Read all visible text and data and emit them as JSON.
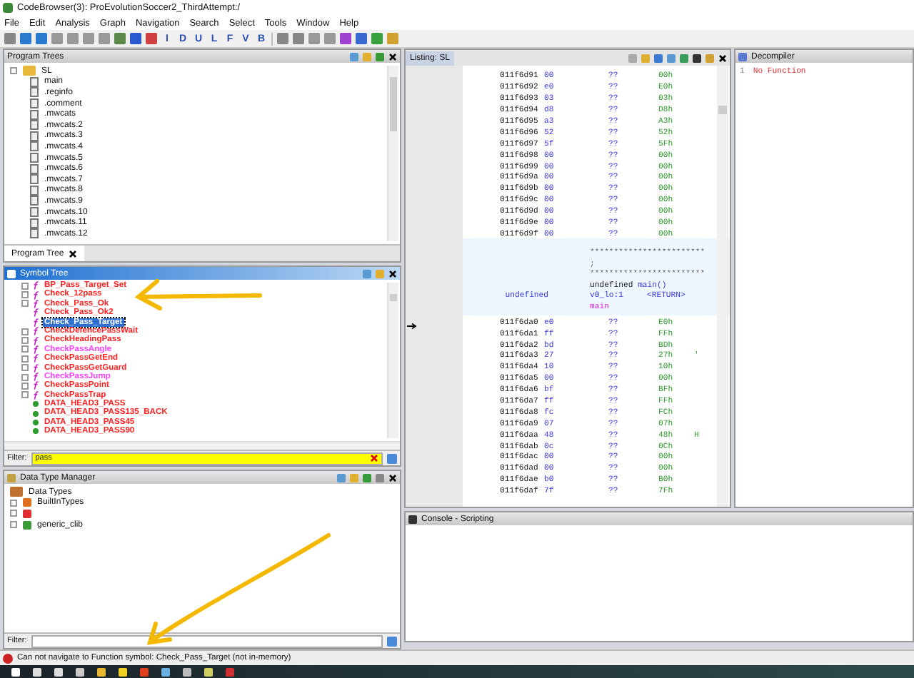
{
  "window": {
    "title": "CodeBrowser(3): ProEvolutionSoccer2_ThirdAttempt:/"
  },
  "menu": [
    "File",
    "Edit",
    "Analysis",
    "Graph",
    "Navigation",
    "Search",
    "Select",
    "Tools",
    "Window",
    "Help"
  ],
  "toolbar": {
    "letter_buttons": [
      "I",
      "D",
      "U",
      "L",
      "F",
      "V",
      "B"
    ]
  },
  "program_trees": {
    "title": "Program Trees",
    "root": "SL",
    "items": [
      "main",
      ".reginfo",
      ".comment",
      ".mwcats",
      ".mwcats.2",
      ".mwcats.3",
      ".mwcats.4",
      ".mwcats.5",
      ".mwcats.6",
      ".mwcats.7",
      ".mwcats.8",
      ".mwcats.9",
      ".mwcats.10",
      ".mwcats.11",
      ".mwcats.12"
    ],
    "tab": "Program Tree"
  },
  "symbol_tree": {
    "title": "Symbol Tree",
    "items": [
      {
        "label": "BP_Pass_Target_Set",
        "kind": "function",
        "color": "#ff2020",
        "expandable": true,
        "selected": false
      },
      {
        "label": "Check_12pass",
        "kind": "function",
        "color": "#ff2020",
        "expandable": true,
        "selected": false
      },
      {
        "label": "Check_Pass_Ok",
        "kind": "function",
        "color": "#ff2020",
        "expandable": true,
        "selected": false
      },
      {
        "label": "Check_Pass_Ok2",
        "kind": "function",
        "color": "#ff2020",
        "expandable": false,
        "selected": false
      },
      {
        "label": "Check_Pass_Target",
        "kind": "function",
        "expandable": false,
        "selected": true
      },
      {
        "label": "CheckDefencePassWait",
        "kind": "function",
        "color": "#ff2020",
        "expandable": true,
        "selected": false
      },
      {
        "label": "CheckHeadingPass",
        "kind": "function",
        "color": "#ff2020",
        "expandable": true,
        "selected": false
      },
      {
        "label": "CheckPassAngle",
        "kind": "function",
        "color": "#ff40ff",
        "expandable": true,
        "selected": false
      },
      {
        "label": "CheckPassGetEnd",
        "kind": "function",
        "color": "#ff2020",
        "expandable": true,
        "selected": false
      },
      {
        "label": "CheckPassGetGuard",
        "kind": "function",
        "color": "#ff2020",
        "expandable": true,
        "selected": false
      },
      {
        "label": "CheckPassJump",
        "kind": "function",
        "color": "#ff40ff",
        "expandable": true,
        "selected": false
      },
      {
        "label": "CheckPassPoint",
        "kind": "function",
        "color": "#ff2020",
        "expandable": true,
        "selected": false
      },
      {
        "label": "CheckPassTrap",
        "kind": "function",
        "color": "#ff2020",
        "expandable": true,
        "selected": false
      },
      {
        "label": "DATA_HEAD3_PASS",
        "kind": "data",
        "color": "#ff2020",
        "expandable": false,
        "selected": false
      },
      {
        "label": "DATA_HEAD3_PASS135_BACK",
        "kind": "data",
        "color": "#ff2020",
        "expandable": false,
        "selected": false
      },
      {
        "label": "DATA_HEAD3_PASS45",
        "kind": "data",
        "color": "#ff2020",
        "expandable": false,
        "selected": false
      },
      {
        "label": "DATA_HEAD3_PASS90",
        "kind": "data",
        "color": "#ff2020",
        "expandable": false,
        "selected": false
      }
    ],
    "filter_label": "Filter:",
    "filter_value": "pass"
  },
  "data_type_manager": {
    "title": "Data Type Manager",
    "root": "Data Types",
    "items": [
      {
        "kind": "builtin",
        "label": "BuiltInTypes"
      },
      {
        "kind": "program"
      },
      {
        "kind": "archive",
        "label": "generic_clib"
      }
    ],
    "filter_label": "Filter:"
  },
  "listing": {
    "tab": "Listing: SL",
    "rows_before": [
      {
        "address": "011f6d91",
        "byte": "00",
        "mnemonic": "??",
        "value": "00h"
      },
      {
        "address": "011f6d92",
        "byte": "e0",
        "mnemonic": "??",
        "value": "E0h"
      },
      {
        "address": "011f6d93",
        "byte": "03",
        "mnemonic": "??",
        "value": "03h"
      },
      {
        "address": "011f6d94",
        "byte": "d8",
        "mnemonic": "??",
        "value": "D8h"
      },
      {
        "address": "011f6d95",
        "byte": "a3",
        "mnemonic": "??",
        "value": "A3h"
      },
      {
        "address": "011f6d96",
        "byte": "52",
        "mnemonic": "??",
        "value": "52h"
      },
      {
        "address": "011f6d97",
        "byte": "5f",
        "mnemonic": "??",
        "value": "5Fh"
      },
      {
        "address": "011f6d98",
        "byte": "00",
        "mnemonic": "??",
        "value": "00h"
      },
      {
        "address": "011f6d99",
        "byte": "00",
        "mnemonic": "??",
        "value": "00h"
      },
      {
        "address": "011f6d9a",
        "byte": "00",
        "mnemonic": "??",
        "value": "00h"
      },
      {
        "address": "011f6d9b",
        "byte": "00",
        "mnemonic": "??",
        "value": "00h"
      },
      {
        "address": "011f6d9c",
        "byte": "00",
        "mnemonic": "??",
        "value": "00h"
      },
      {
        "address": "011f6d9d",
        "byte": "00",
        "mnemonic": "??",
        "value": "00h"
      },
      {
        "address": "011f6d9e",
        "byte": "00",
        "mnemonic": "??",
        "value": "00h"
      },
      {
        "address": "011f6d9f",
        "byte": "00",
        "mnemonic": "??",
        "value": "00h"
      }
    ],
    "function_header": {
      "stars_top": "************************",
      "semicolon": ";",
      "stars_bottom": "************************",
      "signature_type": "undefined",
      "signature_name": "main()",
      "return_type": "undefined",
      "storage": "v0_lo:1",
      "return_label": "<RETURN>",
      "label": "main"
    },
    "rows_after": [
      {
        "address": "011f6da0",
        "byte": "e0",
        "mnemonic": "??",
        "value": "E0h"
      },
      {
        "address": "011f6da1",
        "byte": "ff",
        "mnemonic": "??",
        "value": "FFh"
      },
      {
        "address": "011f6da2",
        "byte": "bd",
        "mnemonic": "??",
        "value": "BDh"
      },
      {
        "address": "011f6da3",
        "byte": "27",
        "mnemonic": "??",
        "value": "27h",
        "char": "'"
      },
      {
        "address": "011f6da4",
        "byte": "10",
        "mnemonic": "??",
        "value": "10h"
      },
      {
        "address": "011f6da5",
        "byte": "00",
        "mnemonic": "??",
        "value": "00h"
      },
      {
        "address": "011f6da6",
        "byte": "bf",
        "mnemonic": "??",
        "value": "BFh"
      },
      {
        "address": "011f6da7",
        "byte": "ff",
        "mnemonic": "??",
        "value": "FFh"
      },
      {
        "address": "011f6da8",
        "byte": "fc",
        "mnemonic": "??",
        "value": "FCh"
      },
      {
        "address": "011f6da9",
        "byte": "07",
        "mnemonic": "??",
        "value": "07h"
      },
      {
        "address": "011f6daa",
        "byte": "48",
        "mnemonic": "??",
        "value": "48h",
        "char": "H"
      },
      {
        "address": "011f6dab",
        "byte": "0c",
        "mnemonic": "??",
        "value": "0Ch"
      },
      {
        "address": "011f6dac",
        "byte": "00",
        "mnemonic": "??",
        "value": "00h"
      },
      {
        "address": "011f6dad",
        "byte": "00",
        "mnemonic": "??",
        "value": "00h"
      },
      {
        "address": "011f6dae",
        "byte": "b0",
        "mnemonic": "??",
        "value": "B0h"
      },
      {
        "address": "011f6daf",
        "byte": "7f",
        "mnemonic": "??",
        "value": "7Fh"
      }
    ]
  },
  "decompiler": {
    "title": "Decompiler",
    "line_number": "1",
    "text": "No Function"
  },
  "console": {
    "title": "Console - Scripting"
  },
  "status_bar": {
    "message": "Can not navigate to Function symbol: Check_Pass_Target (not in-memory)"
  }
}
